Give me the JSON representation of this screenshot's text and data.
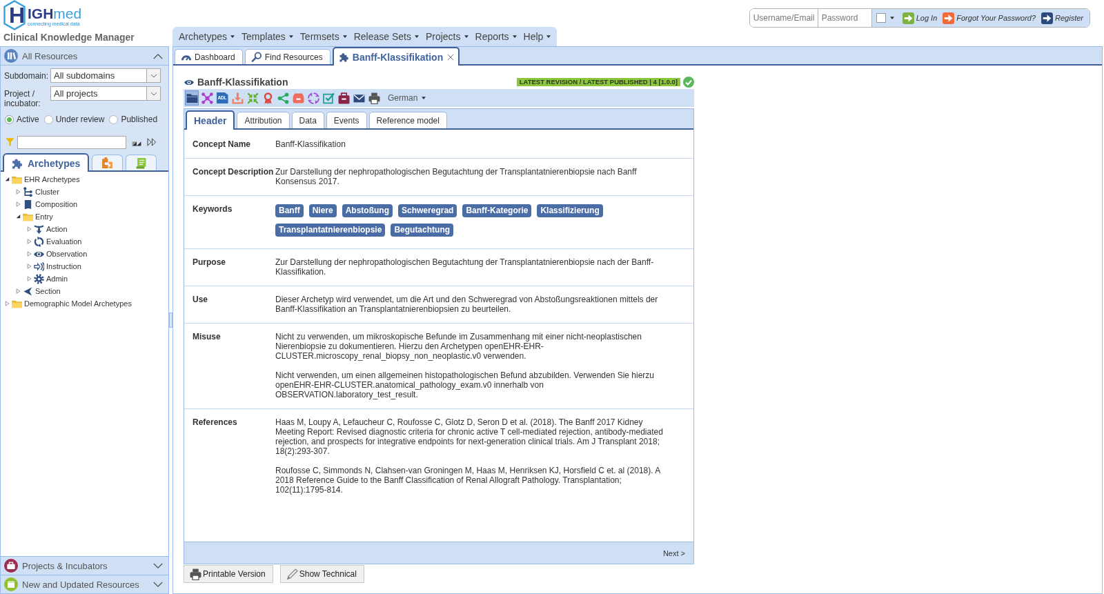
{
  "header": {
    "logo": {
      "mark": "H",
      "wordmark": "**IGH**med",
      "tagline": "connecting medical data"
    },
    "app_title": "Clinical Knowledge Manager",
    "menu": [
      "Archetypes",
      "Templates",
      "Termsets",
      "Release Sets",
      "Projects",
      "Reports",
      "Help"
    ],
    "login": {
      "username": {
        "placeholder": "Username/Email"
      },
      "password": {
        "placeholder": "Password"
      },
      "remember": {
        "checked": false
      },
      "links": [
        {
          "label": "Log In",
          "color": "#7cb342"
        },
        {
          "label": "Forgot Your Password?",
          "color": "#f26b3a"
        },
        {
          "label": "Register",
          "color": "#2d4a7c"
        }
      ]
    }
  },
  "left_panel": {
    "header": {
      "title": "All Resources",
      "expanded": true
    },
    "subdomain": {
      "label": "Subdomain:",
      "value": "All subdomains"
    },
    "project": {
      "label": "Project / incubator:",
      "value": "All projects"
    },
    "status_filter": [
      {
        "label": "Active",
        "selected": true
      },
      {
        "label": "Under review",
        "selected": false
      },
      {
        "label": "Published",
        "selected": false
      }
    ],
    "tabs": [
      {
        "kind": "archetypes",
        "label": "Archetypes",
        "selected": true
      },
      {
        "kind": "templates",
        "selected": false
      },
      {
        "kind": "termsets",
        "selected": false
      }
    ],
    "tree": [
      {
        "kind": "folder",
        "label": "EHR Archetypes",
        "expanded": true,
        "children": [
          {
            "kind": "cluster",
            "label": "Cluster",
            "expanded": false
          },
          {
            "kind": "composition",
            "label": "Composition",
            "expanded": false
          },
          {
            "kind": "folder",
            "label": "Entry",
            "expanded": true,
            "children": [
              {
                "kind": "action",
                "label": "Action",
                "expanded": false
              },
              {
                "kind": "evaluation",
                "label": "Evaluation",
                "expanded": false
              },
              {
                "kind": "observation",
                "label": "Observation",
                "expanded": false
              },
              {
                "kind": "instruction",
                "label": "Instruction",
                "expanded": false
              },
              {
                "kind": "admin",
                "label": "Admin",
                "expanded": false
              }
            ]
          },
          {
            "kind": "section",
            "label": "Section",
            "expanded": false
          }
        ]
      },
      {
        "kind": "folder",
        "label": "Demographic Model Archetypes",
        "expanded": false
      }
    ],
    "sections": [
      {
        "kind": "projects",
        "title": "Projects & Incubators",
        "expanded": false
      },
      {
        "kind": "updates",
        "title": "New and Updated Resources",
        "expanded": false
      }
    ]
  },
  "content": {
    "tabs": [
      {
        "kind": "dashboard",
        "label": "Dashboard",
        "selected": false,
        "closable": false
      },
      {
        "kind": "search",
        "label": "Find Resources",
        "selected": false,
        "closable": false
      },
      {
        "kind": "archetype",
        "label": "Banff-Klassifikation",
        "selected": true,
        "closable": true
      }
    ],
    "document": {
      "title": "Banff-Klassifikation",
      "status": "LATEST REVISION / LATEST PUBLISHED | 4 [1.0.0]",
      "toolbar": [
        {
          "kind": "overview",
          "selected": true
        },
        {
          "kind": "mindmap",
          "selected": false
        },
        {
          "kind": "adl",
          "label": "ADL",
          "selected": false
        },
        {
          "kind": "download",
          "selected": false
        },
        {
          "kind": "compress",
          "selected": false
        },
        {
          "kind": "award",
          "selected": false
        },
        {
          "kind": "share",
          "selected": false
        },
        {
          "kind": "archive",
          "selected": false
        },
        {
          "kind": "cycle",
          "selected": false
        },
        {
          "kind": "checklist",
          "selected": false
        },
        {
          "kind": "portfolio",
          "selected": false
        },
        {
          "kind": "mail",
          "selected": false
        },
        {
          "kind": "print",
          "selected": false
        }
      ],
      "language": "German",
      "tabs": [
        {
          "label": "Header",
          "selected": true
        },
        {
          "label": "Attribution",
          "selected": false
        },
        {
          "label": "Data",
          "selected": false
        },
        {
          "label": "Events",
          "selected": false
        },
        {
          "label": "Reference model",
          "selected": false
        }
      ],
      "rows": [
        {
          "kind": "text",
          "label": "Concept Name",
          "paragraphs": [
            "Banff-Klassifikation"
          ]
        },
        {
          "kind": "text",
          "label": "Concept Description",
          "paragraphs": [
            "Zur Darstellung der nephropathologischen Begutachtung der Transplantatnierenbiopsie nach Banff Konsensus 2017."
          ]
        },
        {
          "kind": "keywords",
          "label": "Keywords",
          "keywords": [
            "Banff",
            "Niere",
            "Abstoßung",
            "Schweregrad",
            "Banff-Kategorie",
            "Klassifizierung",
            "Transplantatnierenbiopsie",
            "Begutachtung"
          ]
        },
        {
          "kind": "text",
          "label": "Purpose",
          "paragraphs": [
            "Zur Darstellung der nephropathologischen Begutachtung der Transplantatnierenbiopsie nach der Banff-Klassifikation."
          ]
        },
        {
          "kind": "text",
          "label": "Use",
          "paragraphs": [
            "Dieser Archetyp wird verwendet, um die Art und den Schweregrad von Abstoßungsreaktionen mittels der Banff-Klassifikation an Transplantatnierenbiopsien zu beurteilen."
          ]
        },
        {
          "kind": "text",
          "label": "Misuse",
          "paragraphs": [
            "Nicht zu verwenden, um mikroskopische Befunde im Zusammenhang mit einer nicht-neoplastischen Nierenbiopsie zu dokumentieren. Hierzu den Archetypen openEHR-EHR-CLUSTER.microscopy_renal_biopsy_non_neoplastic.v0 verwenden.",
            "Nicht verwenden, um einen allgemeinen histopathologischen Befund abzubilden. Verwenden Sie hierzu openEHR-EHR-CLUSTER.anatomical_pathology_exam.v0 innerhalb von OBSERVATION.laboratory_test_result."
          ]
        },
        {
          "kind": "text",
          "label": "References",
          "paragraphs": [
            "Haas M, Loupy A, Lefaucheur C, Roufosse C, Glotz D, Seron D et al. (2018). The Banff 2017 Kidney Meeting Report: Revised diagnostic criteria for chronic active T cell-mediated rejection, antibody-mediated rejection, and prospects for integrative endpoints for next-generation clinical trials. Am J Transplant 2018; 18(2):293-307.",
            "Roufosse C, Simmonds N, Clahsen-van Groningen M, Haas M, Henriksen KJ, Horsfield C et. al (2018). A 2018 Reference Guide to the Banff Classification of Renal Allograft Pathology. Transplantation; 102(11):1795-814."
          ]
        }
      ],
      "next": "Next >"
    },
    "buttons": [
      {
        "kind": "print",
        "label": "Printable Version"
      },
      {
        "kind": "technical",
        "label": "Show Technical"
      }
    ]
  }
}
